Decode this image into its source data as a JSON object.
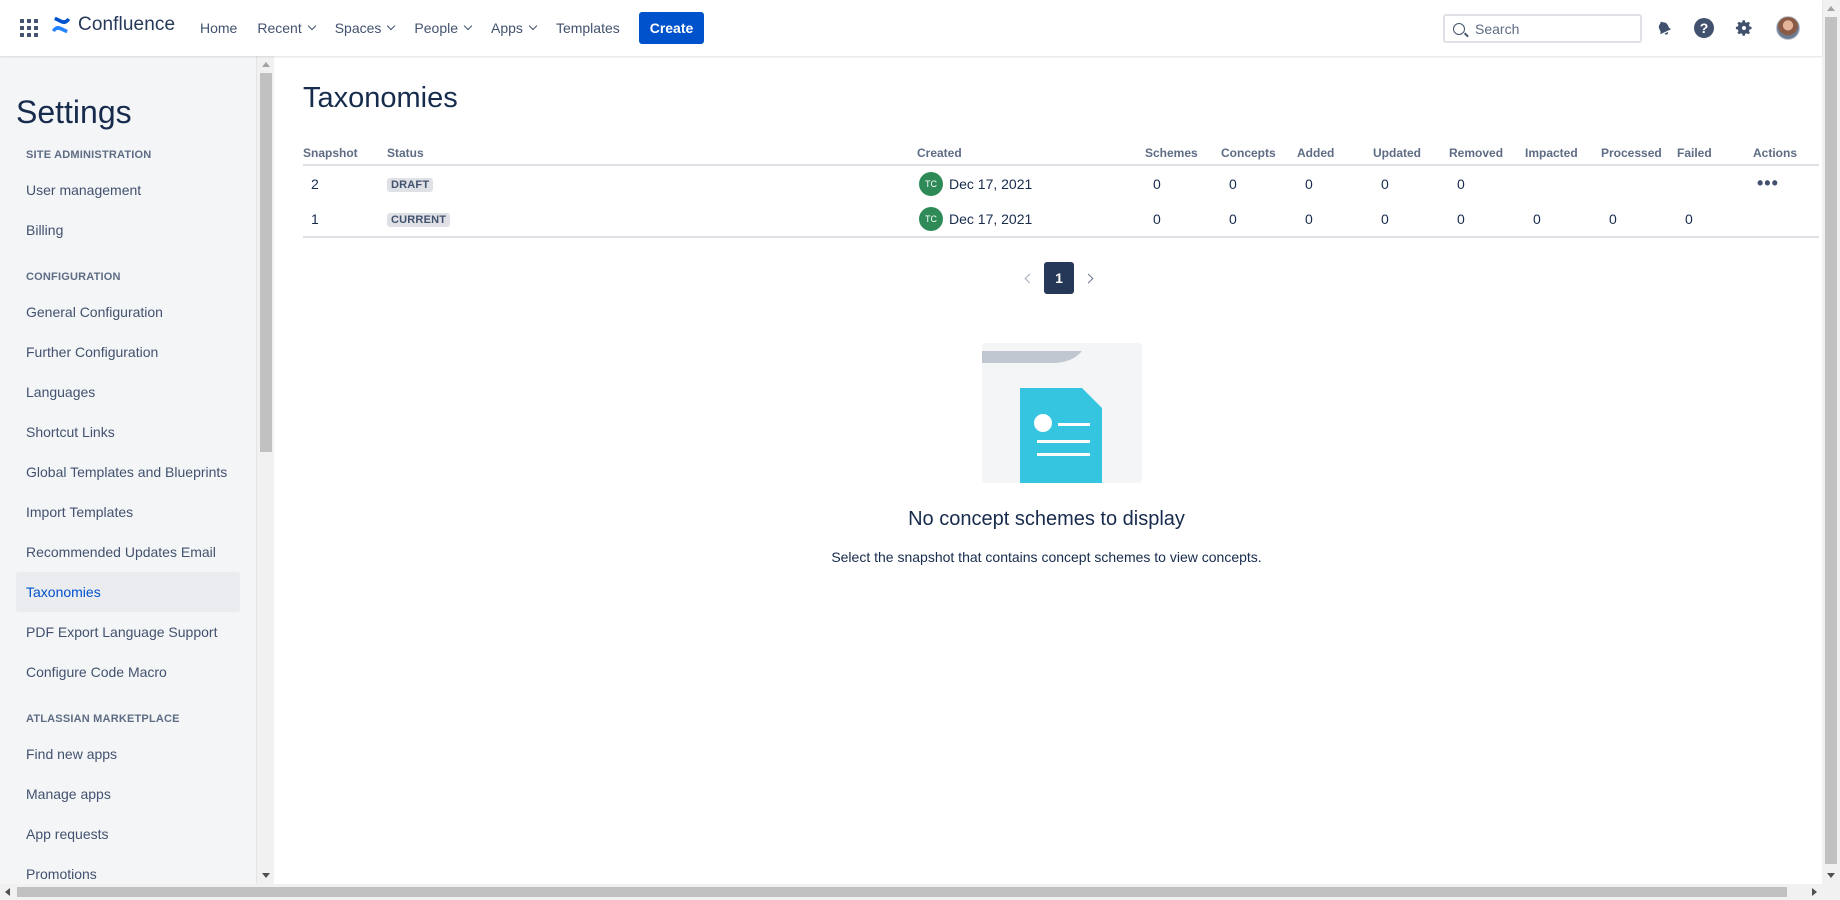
{
  "app": {
    "logo_text": "Confluence",
    "brand_color": "#0052cc"
  },
  "topnav": {
    "items": [
      {
        "label": "Home",
        "has_dropdown": false
      },
      {
        "label": "Recent",
        "has_dropdown": true
      },
      {
        "label": "Spaces",
        "has_dropdown": true
      },
      {
        "label": "People",
        "has_dropdown": true
      },
      {
        "label": "Apps",
        "has_dropdown": true
      },
      {
        "label": "Templates",
        "has_dropdown": false
      }
    ],
    "create_label": "Create",
    "search_placeholder": "Search",
    "help_glyph": "?",
    "icons": [
      "app-switcher-icon",
      "notifications-bell-icon",
      "help-icon",
      "settings-gear-icon",
      "user-avatar"
    ]
  },
  "sidebar": {
    "title": "Settings",
    "sections": [
      {
        "heading": "SITE ADMINISTRATION",
        "items": [
          "User management",
          "Billing"
        ]
      },
      {
        "heading": "CONFIGURATION",
        "items": [
          "General Configuration",
          "Further Configuration",
          "Languages",
          "Shortcut Links",
          "Global Templates and Blueprints",
          "Import Templates",
          "Recommended Updates Email",
          "Taxonomies",
          "PDF Export Language Support",
          "Configure Code Macro"
        ]
      },
      {
        "heading": "ATLASSIAN MARKETPLACE",
        "items": [
          "Find new apps",
          "Manage apps",
          "App requests",
          "Promotions"
        ]
      }
    ],
    "active_item": "Taxonomies"
  },
  "main": {
    "title": "Taxonomies",
    "table": {
      "headers": [
        "Snapshot",
        "Status",
        "Created",
        "Schemes",
        "Concepts",
        "Added",
        "Updated",
        "Removed",
        "Impacted",
        "Processed",
        "Failed",
        "Actions"
      ],
      "rows": [
        {
          "snapshot": "2",
          "status": "DRAFT",
          "user_initials": "TC",
          "created": "Dec 17, 2021",
          "schemes": "0",
          "concepts": "0",
          "added": "0",
          "updated": "0",
          "removed": "0",
          "impacted": "",
          "processed": "",
          "failed": "",
          "has_actions": true
        },
        {
          "snapshot": "1",
          "status": "CURRENT",
          "user_initials": "TC",
          "created": "Dec 17, 2021",
          "schemes": "0",
          "concepts": "0",
          "added": "0",
          "updated": "0",
          "removed": "0",
          "impacted": "0",
          "processed": "0",
          "failed": "0",
          "has_actions": false
        }
      ]
    },
    "pagination": {
      "current_page": "1"
    },
    "empty_state": {
      "title": "No concept schemes to display",
      "description": "Select the snapshot that contains concept schemes to view concepts."
    }
  }
}
